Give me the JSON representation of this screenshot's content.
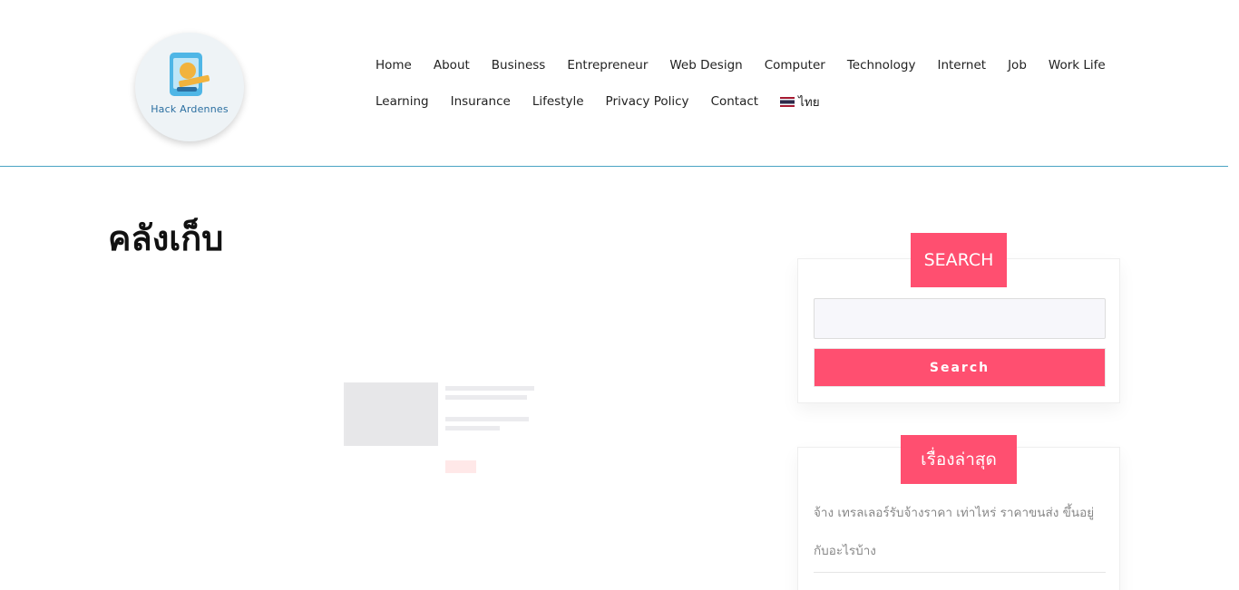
{
  "site": {
    "logo_text": "Hack Ardennes"
  },
  "nav": {
    "row1": [
      "Home",
      "About",
      "Business",
      "Entrepreneur",
      "Web Design",
      "Computer",
      "Technology",
      "Internet",
      "Job",
      "Work Life"
    ],
    "row2": [
      "Learning",
      "Insurance",
      "Lifestyle",
      "Privacy Policy",
      "Contact"
    ],
    "language_label": "ไทย",
    "language_icon": "thai-flag-icon"
  },
  "main": {
    "title": "คลังเก็บ"
  },
  "sidebar": {
    "search": {
      "title": "SEARCH",
      "placeholder": "",
      "button_label": "Search"
    },
    "recent": {
      "title": "เรื่องล่าสุด",
      "items": [
        "จ้าง เทรลเลอร์รับจ้างราคา เท่าไหร่ ราคาขนส่ง ขึ้นอยู่กับอะไรบ้าง"
      ]
    }
  },
  "colors": {
    "accent": "#ff4f70",
    "header_border": "#4aa3c4"
  }
}
